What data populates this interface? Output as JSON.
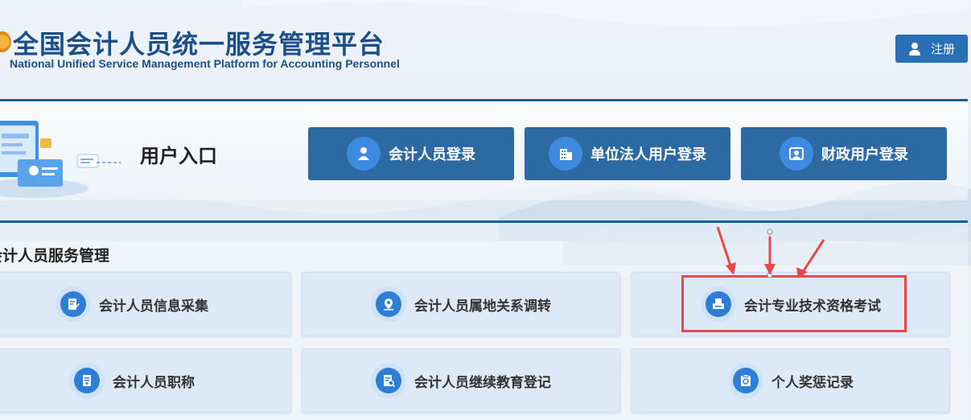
{
  "header": {
    "title": "全国会计人员统一服务管理平台",
    "subtitle": "National Unified Service Management Platform for Accounting Personnel",
    "register_label": "注册"
  },
  "entry": {
    "title": "用户入口",
    "buttons": [
      {
        "label": "会计人员登录",
        "icon": "user-icon"
      },
      {
        "label": "单位法人用户登录",
        "icon": "building-icon"
      },
      {
        "label": "财政用户登录",
        "icon": "id-card-icon"
      }
    ]
  },
  "services": {
    "heading": "会计人员服务管理",
    "items": [
      {
        "label": "会计人员信息采集",
        "icon": "edit-document-icon"
      },
      {
        "label": "会计人员属地关系调转",
        "icon": "location-pin-icon"
      },
      {
        "label": "会计专业技术资格考试",
        "icon": "printer-icon"
      },
      {
        "label": "会计人员职称",
        "icon": "title-document-icon"
      },
      {
        "label": "会计人员继续教育登记",
        "icon": "search-document-icon"
      },
      {
        "label": "个人奖惩记录",
        "icon": "record-icon"
      }
    ]
  },
  "colors": {
    "brand_blue": "#1c4f8a",
    "button_blue": "#2d6aa3",
    "icon_blue": "#3c8be0",
    "card_bg": "#dde9f6",
    "highlight_red": "#e8474a"
  }
}
